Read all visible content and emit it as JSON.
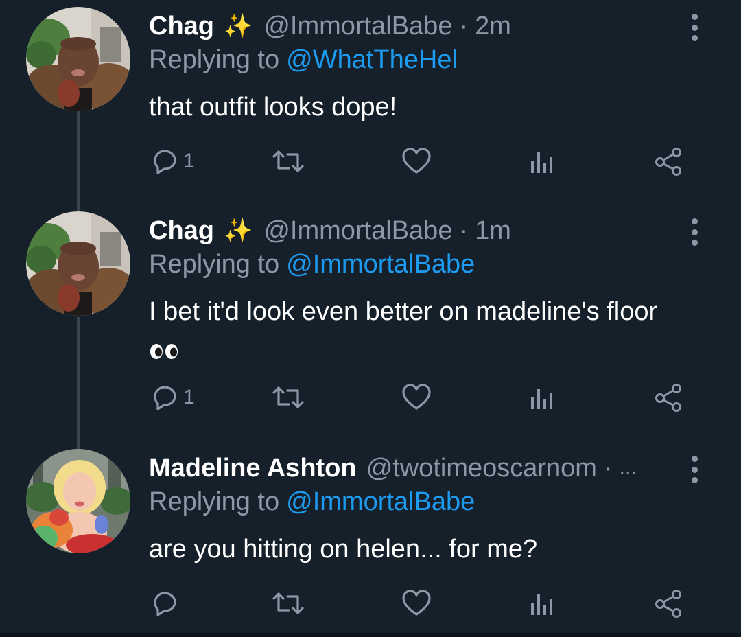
{
  "tweets": [
    {
      "name": "Chag",
      "badge": "✨",
      "handle": "@ImmortalBabe",
      "separator": "·",
      "time": "2m",
      "replying_prefix": "Replying to",
      "replying_to": "@WhatTheHel",
      "text": "that outfit looks dope!",
      "reply_count": "1",
      "avatar": "chag-avatar"
    },
    {
      "name": "Chag",
      "badge": "✨",
      "handle": "@ImmortalBabe",
      "separator": "·",
      "time": "1m",
      "replying_prefix": "Replying to",
      "replying_to": "@ImmortalBabe",
      "text": "I bet it'd look even better on madeline's floor",
      "emoji": "👀",
      "reply_count": "1",
      "avatar": "chag-avatar"
    },
    {
      "name": "Madeline Ashton",
      "badge": "",
      "handle": "@twotimeoscarnom",
      "separator": "·",
      "time": "...",
      "replying_prefix": "Replying to",
      "replying_to": "@ImmortalBabe",
      "text": "are you hitting on helen... for me?",
      "reply_count": "",
      "avatar": "madeline-avatar"
    }
  ],
  "icons": {
    "reply": "reply-icon",
    "retweet": "retweet-icon",
    "like": "heart-icon",
    "analytics": "analytics-icon",
    "share": "share-icon",
    "more": "more-vertical-icon"
  },
  "colors": {
    "background": "#15202b",
    "text": "#ffffff",
    "secondary": "#8b98a5",
    "link": "#1d9bf0",
    "thread_line": "#38444d"
  }
}
